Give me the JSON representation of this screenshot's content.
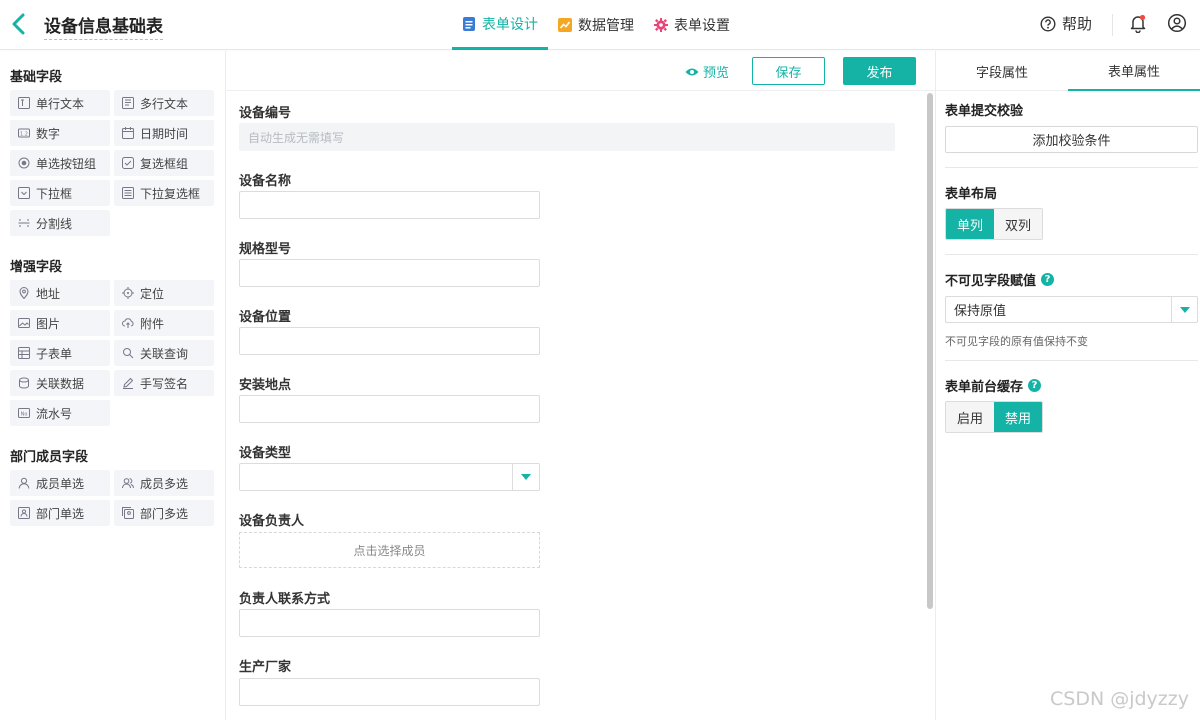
{
  "header": {
    "title": "设备信息基础表",
    "tabs": [
      {
        "label": "表单设计",
        "icon": "document-icon"
      },
      {
        "label": "数据管理",
        "icon": "chart-icon"
      },
      {
        "label": "表单设置",
        "icon": "gear-icon"
      }
    ],
    "active_tab": "表单设计",
    "help_label": "帮助"
  },
  "palette": {
    "groups": [
      {
        "title": "基础字段",
        "items": [
          "单行文本",
          "多行文本",
          "数字",
          "日期时间",
          "单选按钮组",
          "复选框组",
          "下拉框",
          "下拉复选框",
          "分割线"
        ]
      },
      {
        "title": "增强字段",
        "items": [
          "地址",
          "定位",
          "图片",
          "附件",
          "子表单",
          "关联查询",
          "关联数据",
          "手写签名",
          "流水号"
        ]
      },
      {
        "title": "部门成员字段",
        "items": [
          "成员单选",
          "成员多选",
          "部门单选",
          "部门多选"
        ]
      }
    ]
  },
  "toolbar": {
    "preview_label": "预览",
    "save_label": "保存",
    "publish_label": "发布"
  },
  "form": {
    "fields": [
      {
        "label": "设备编号",
        "type": "disabled",
        "placeholder": "自动生成无需填写"
      },
      {
        "label": "设备名称",
        "type": "text"
      },
      {
        "label": "规格型号",
        "type": "text"
      },
      {
        "label": "设备位置",
        "type": "text"
      },
      {
        "label": "安装地点",
        "type": "text"
      },
      {
        "label": "设备类型",
        "type": "select"
      },
      {
        "label": "设备负责人",
        "type": "member",
        "placeholder": "点击选择成员"
      },
      {
        "label": "负责人联系方式",
        "type": "text"
      },
      {
        "label": "生产厂家",
        "type": "text"
      }
    ]
  },
  "right_panel": {
    "tabs": [
      "字段属性",
      "表单属性"
    ],
    "active_tab": "表单属性",
    "submit_validation": {
      "title": "表单提交校验",
      "button_label": "添加校验条件"
    },
    "layout": {
      "title": "表单布局",
      "options": [
        "单列",
        "双列"
      ],
      "selected": "单列"
    },
    "invisible_assign": {
      "title": "不可见字段赋值",
      "value": "保持原值",
      "hint": "不可见字段的原有值保持不变"
    },
    "cache": {
      "title": "表单前台缓存",
      "options": [
        "启用",
        "禁用"
      ],
      "selected": "禁用"
    }
  },
  "watermark": "CSDN @jdyzzy",
  "colors": {
    "accent": "#15b3a6",
    "chart_icon": "#f5a623",
    "gear_icon": "#e8457a",
    "doc_icon": "#3a7bd5",
    "bell_dot": "#f04a3a"
  }
}
